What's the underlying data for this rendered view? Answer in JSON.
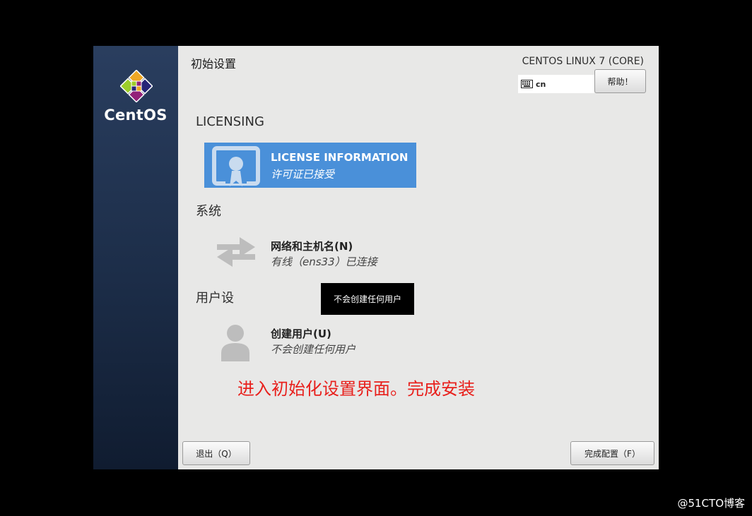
{
  "branding": {
    "logo_text": "CentOS"
  },
  "header": {
    "title": "初始设置",
    "product": "CENTOS LINUX 7 (CORE)",
    "keyboard_layout": "cn",
    "help_label": "帮助！"
  },
  "sections": [
    {
      "heading": "LICENSING",
      "spokes": [
        {
          "icon": "license-icon",
          "title": "LICENSE INFORMATION",
          "status": "许可证已接受",
          "selected": true
        }
      ]
    },
    {
      "heading": "系统",
      "spokes": [
        {
          "icon": "network-icon",
          "title": "网络和主机名(N)",
          "status": "有线（ens33）已连接"
        }
      ]
    },
    {
      "heading": "用户设",
      "spokes": [
        {
          "icon": "user-icon",
          "title": "创建用户(U)",
          "status": "不会创建任何用户"
        }
      ]
    }
  ],
  "tooltip": "不会创建任何用户",
  "annotation": "进入初始化设置界面。完成安装",
  "footer": {
    "quit_label": "退出（Q）",
    "finish_label": "完成配置（F）"
  },
  "watermark": "@51CTO博客",
  "colors": {
    "accent": "#4a90d9",
    "annotation": "#e8201c",
    "sidebar": "#1c2d48"
  }
}
